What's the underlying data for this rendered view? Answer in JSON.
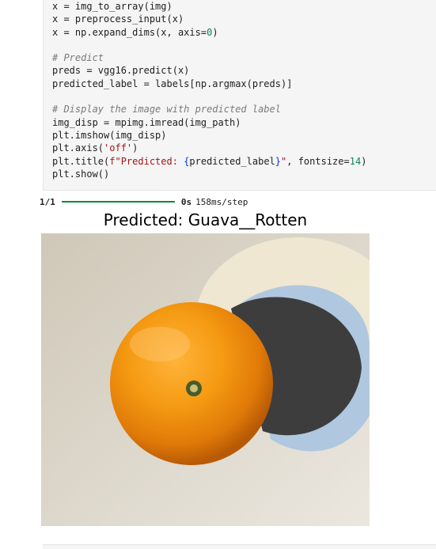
{
  "code_cell": {
    "lines": [
      "x = img_to_array(img)",
      "x = preprocess_input(x)",
      "x = np.expand_dims(x, axis=0)",
      "",
      "# Predict",
      "preds = vgg16.predict(x)",
      "predicted_label = labels[np.argmax(preds)]",
      "",
      "# Display the image with predicted label",
      "img_disp = mpimg.imread(img_path)",
      "plt.imshow(img_disp)",
      "plt.axis('off')",
      "plt.title(f\"Predicted: {predicted_label}\", fontsize=14)",
      "plt.show()"
    ]
  },
  "output": {
    "progress_count": "1/1",
    "progress": 1.0,
    "elapsed": "0s",
    "per_step": "158ms/step",
    "plot_title": "Predicted: Guava__Rotten"
  },
  "colors": {
    "cell_background": "#f5f5f5",
    "progress_bar": "#0a8a3a",
    "number": "#098658",
    "string": "#a31515",
    "comment": "#7a7a7a"
  }
}
